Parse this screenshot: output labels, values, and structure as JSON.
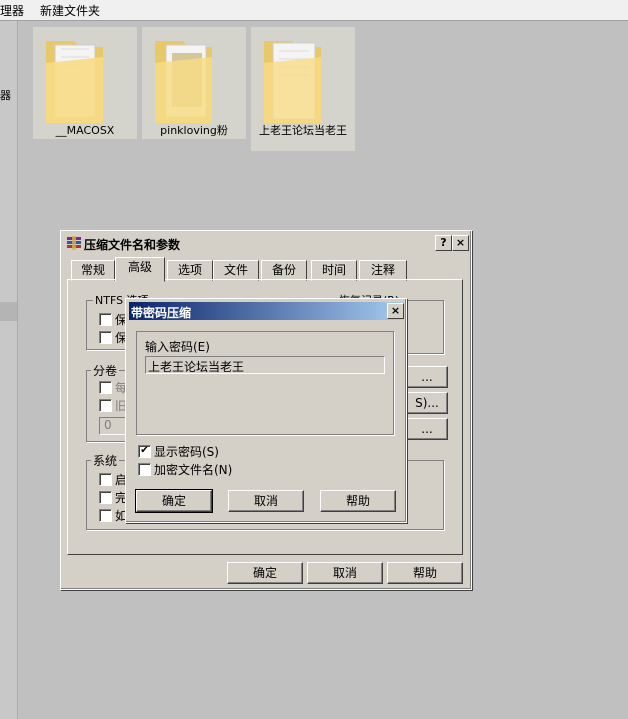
{
  "explorer": {
    "menu": [
      "理器",
      "新建文件夹"
    ],
    "left_fragment": "器",
    "items": [
      {
        "name": "__MACOSX",
        "icon": "folder-icon"
      },
      {
        "name": "pinkloving粉",
        "icon": "folder-icon"
      },
      {
        "name": "上老王论坛当老王",
        "icon": "folder-icon"
      }
    ]
  },
  "winrar_dialog": {
    "title": "压缩文件名和参数",
    "help_label": "?",
    "close_label": "×",
    "tabs": [
      "常规",
      "高级",
      "选项",
      "文件",
      "备份",
      "时间",
      "注释"
    ],
    "active_tab": "高级",
    "ntfs_label": "NTFS 选项",
    "ntfs_opt1": "保",
    "ntfs_opt2": "保",
    "recovery_label": "恢复记录(R)",
    "volume_label": "分卷",
    "vol_opt1": "每",
    "vol_opt2": "旧",
    "vol_field": "0",
    "system_label": "系统",
    "sys_opt1": "启",
    "sys_opt2": "完",
    "sys_opt3": "如",
    "side_btn1": "...",
    "side_btn2": "S)...",
    "side_btn3": "...",
    "ok": "确定",
    "cancel": "取消",
    "help": "帮助"
  },
  "password_dialog": {
    "title": "带密码压缩",
    "close_label": "×",
    "prompt": "输入密码(E)",
    "password": "上老王论坛当老王",
    "show_password_label": "显示密码(S)",
    "show_password_checked": true,
    "check_mark": "✔",
    "encrypt_filenames_label": "加密文件名(N)",
    "encrypt_filenames_checked": false,
    "ok": "确定",
    "cancel": "取消",
    "help": "帮助"
  }
}
